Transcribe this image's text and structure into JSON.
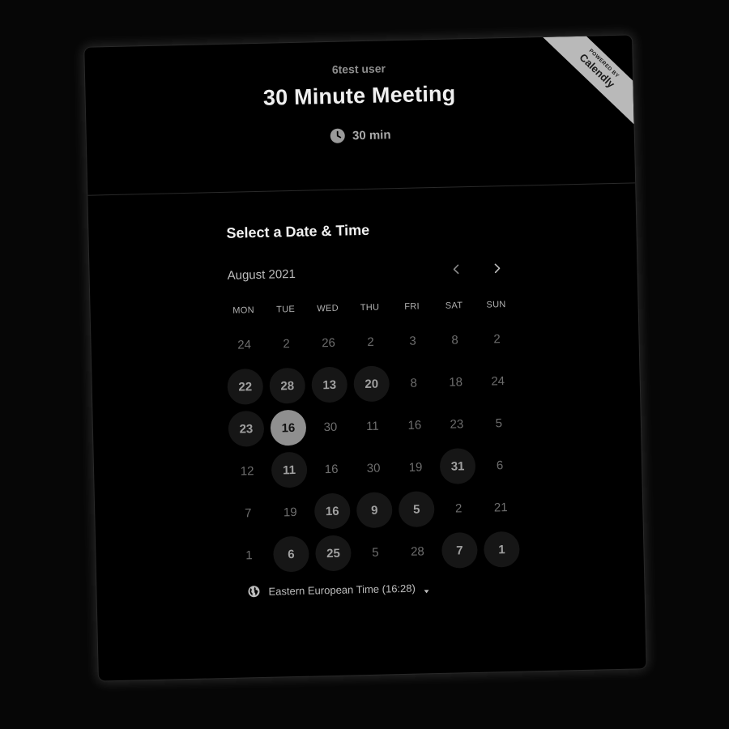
{
  "header": {
    "host_name": "6test user",
    "event_title": "30 Minute Meeting",
    "duration": "30 min",
    "duration_icon": "clock-icon"
  },
  "badge": {
    "top_text": "POWERED BY",
    "brand": "Calendly"
  },
  "scheduler": {
    "section_title": "Select a Date & Time",
    "month_label": "August 2021",
    "prev_icon": "chevron-left-icon",
    "next_icon": "chevron-right-icon",
    "weekdays": [
      "MON",
      "TUE",
      "WED",
      "THU",
      "FRI",
      "SAT",
      "SUN"
    ],
    "days": [
      {
        "label": "24",
        "state": "unavailable"
      },
      {
        "label": "2",
        "state": "unavailable"
      },
      {
        "label": "26",
        "state": "unavailable"
      },
      {
        "label": "2",
        "state": "unavailable"
      },
      {
        "label": "3",
        "state": "unavailable"
      },
      {
        "label": "8",
        "state": "unavailable"
      },
      {
        "label": "2",
        "state": "unavailable"
      },
      {
        "label": "22",
        "state": "available"
      },
      {
        "label": "28",
        "state": "available"
      },
      {
        "label": "13",
        "state": "available"
      },
      {
        "label": "20",
        "state": "available"
      },
      {
        "label": "8",
        "state": "unavailable"
      },
      {
        "label": "18",
        "state": "unavailable"
      },
      {
        "label": "24",
        "state": "unavailable"
      },
      {
        "label": "23",
        "state": "available"
      },
      {
        "label": "16",
        "state": "selected"
      },
      {
        "label": "30",
        "state": "unavailable"
      },
      {
        "label": "11",
        "state": "unavailable"
      },
      {
        "label": "16",
        "state": "unavailable"
      },
      {
        "label": "23",
        "state": "unavailable"
      },
      {
        "label": "5",
        "state": "unavailable"
      },
      {
        "label": "12",
        "state": "unavailable"
      },
      {
        "label": "11",
        "state": "available"
      },
      {
        "label": "16",
        "state": "unavailable"
      },
      {
        "label": "30",
        "state": "unavailable"
      },
      {
        "label": "19",
        "state": "unavailable"
      },
      {
        "label": "31",
        "state": "available"
      },
      {
        "label": "6",
        "state": "unavailable"
      },
      {
        "label": "7",
        "state": "unavailable"
      },
      {
        "label": "19",
        "state": "unavailable"
      },
      {
        "label": "16",
        "state": "available"
      },
      {
        "label": "9",
        "state": "available"
      },
      {
        "label": "5",
        "state": "available"
      },
      {
        "label": "2",
        "state": "unavailable"
      },
      {
        "label": "21",
        "state": "unavailable"
      },
      {
        "label": "1",
        "state": "unavailable"
      },
      {
        "label": "6",
        "state": "available"
      },
      {
        "label": "25",
        "state": "available"
      },
      {
        "label": "5",
        "state": "unavailable"
      },
      {
        "label": "28",
        "state": "unavailable"
      },
      {
        "label": "7",
        "state": "available"
      },
      {
        "label": "1",
        "state": "available"
      }
    ],
    "timezone_label": "Eastern European Time (16:28)",
    "timezone_icon": "globe-icon"
  },
  "colors": {
    "background": "#000000",
    "available_bg": "#161616",
    "selected_bg": "#8f8f8f",
    "ribbon": "#b9b9b9"
  }
}
